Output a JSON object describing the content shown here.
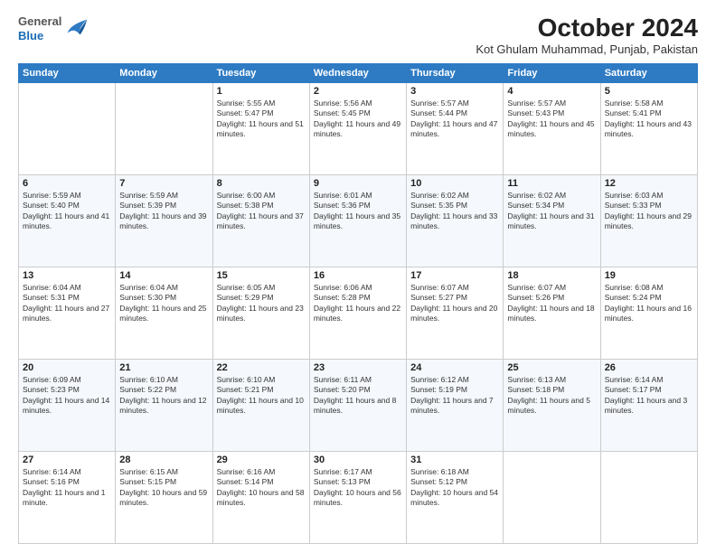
{
  "header": {
    "logo": {
      "general": "General",
      "blue": "Blue"
    },
    "title": "October 2024",
    "location": "Kot Ghulam Muhammad, Punjab, Pakistan"
  },
  "calendar": {
    "headers": [
      "Sunday",
      "Monday",
      "Tuesday",
      "Wednesday",
      "Thursday",
      "Friday",
      "Saturday"
    ],
    "weeks": [
      [
        {
          "day": "",
          "info": ""
        },
        {
          "day": "",
          "info": ""
        },
        {
          "day": "1",
          "info": "Sunrise: 5:55 AM\nSunset: 5:47 PM\nDaylight: 11 hours and 51 minutes."
        },
        {
          "day": "2",
          "info": "Sunrise: 5:56 AM\nSunset: 5:45 PM\nDaylight: 11 hours and 49 minutes."
        },
        {
          "day": "3",
          "info": "Sunrise: 5:57 AM\nSunset: 5:44 PM\nDaylight: 11 hours and 47 minutes."
        },
        {
          "day": "4",
          "info": "Sunrise: 5:57 AM\nSunset: 5:43 PM\nDaylight: 11 hours and 45 minutes."
        },
        {
          "day": "5",
          "info": "Sunrise: 5:58 AM\nSunset: 5:41 PM\nDaylight: 11 hours and 43 minutes."
        }
      ],
      [
        {
          "day": "6",
          "info": "Sunrise: 5:59 AM\nSunset: 5:40 PM\nDaylight: 11 hours and 41 minutes."
        },
        {
          "day": "7",
          "info": "Sunrise: 5:59 AM\nSunset: 5:39 PM\nDaylight: 11 hours and 39 minutes."
        },
        {
          "day": "8",
          "info": "Sunrise: 6:00 AM\nSunset: 5:38 PM\nDaylight: 11 hours and 37 minutes."
        },
        {
          "day": "9",
          "info": "Sunrise: 6:01 AM\nSunset: 5:36 PM\nDaylight: 11 hours and 35 minutes."
        },
        {
          "day": "10",
          "info": "Sunrise: 6:02 AM\nSunset: 5:35 PM\nDaylight: 11 hours and 33 minutes."
        },
        {
          "day": "11",
          "info": "Sunrise: 6:02 AM\nSunset: 5:34 PM\nDaylight: 11 hours and 31 minutes."
        },
        {
          "day": "12",
          "info": "Sunrise: 6:03 AM\nSunset: 5:33 PM\nDaylight: 11 hours and 29 minutes."
        }
      ],
      [
        {
          "day": "13",
          "info": "Sunrise: 6:04 AM\nSunset: 5:31 PM\nDaylight: 11 hours and 27 minutes."
        },
        {
          "day": "14",
          "info": "Sunrise: 6:04 AM\nSunset: 5:30 PM\nDaylight: 11 hours and 25 minutes."
        },
        {
          "day": "15",
          "info": "Sunrise: 6:05 AM\nSunset: 5:29 PM\nDaylight: 11 hours and 23 minutes."
        },
        {
          "day": "16",
          "info": "Sunrise: 6:06 AM\nSunset: 5:28 PM\nDaylight: 11 hours and 22 minutes."
        },
        {
          "day": "17",
          "info": "Sunrise: 6:07 AM\nSunset: 5:27 PM\nDaylight: 11 hours and 20 minutes."
        },
        {
          "day": "18",
          "info": "Sunrise: 6:07 AM\nSunset: 5:26 PM\nDaylight: 11 hours and 18 minutes."
        },
        {
          "day": "19",
          "info": "Sunrise: 6:08 AM\nSunset: 5:24 PM\nDaylight: 11 hours and 16 minutes."
        }
      ],
      [
        {
          "day": "20",
          "info": "Sunrise: 6:09 AM\nSunset: 5:23 PM\nDaylight: 11 hours and 14 minutes."
        },
        {
          "day": "21",
          "info": "Sunrise: 6:10 AM\nSunset: 5:22 PM\nDaylight: 11 hours and 12 minutes."
        },
        {
          "day": "22",
          "info": "Sunrise: 6:10 AM\nSunset: 5:21 PM\nDaylight: 11 hours and 10 minutes."
        },
        {
          "day": "23",
          "info": "Sunrise: 6:11 AM\nSunset: 5:20 PM\nDaylight: 11 hours and 8 minutes."
        },
        {
          "day": "24",
          "info": "Sunrise: 6:12 AM\nSunset: 5:19 PM\nDaylight: 11 hours and 7 minutes."
        },
        {
          "day": "25",
          "info": "Sunrise: 6:13 AM\nSunset: 5:18 PM\nDaylight: 11 hours and 5 minutes."
        },
        {
          "day": "26",
          "info": "Sunrise: 6:14 AM\nSunset: 5:17 PM\nDaylight: 11 hours and 3 minutes."
        }
      ],
      [
        {
          "day": "27",
          "info": "Sunrise: 6:14 AM\nSunset: 5:16 PM\nDaylight: 11 hours and 1 minute."
        },
        {
          "day": "28",
          "info": "Sunrise: 6:15 AM\nSunset: 5:15 PM\nDaylight: 10 hours and 59 minutes."
        },
        {
          "day": "29",
          "info": "Sunrise: 6:16 AM\nSunset: 5:14 PM\nDaylight: 10 hours and 58 minutes."
        },
        {
          "day": "30",
          "info": "Sunrise: 6:17 AM\nSunset: 5:13 PM\nDaylight: 10 hours and 56 minutes."
        },
        {
          "day": "31",
          "info": "Sunrise: 6:18 AM\nSunset: 5:12 PM\nDaylight: 10 hours and 54 minutes."
        },
        {
          "day": "",
          "info": ""
        },
        {
          "day": "",
          "info": ""
        }
      ]
    ]
  }
}
